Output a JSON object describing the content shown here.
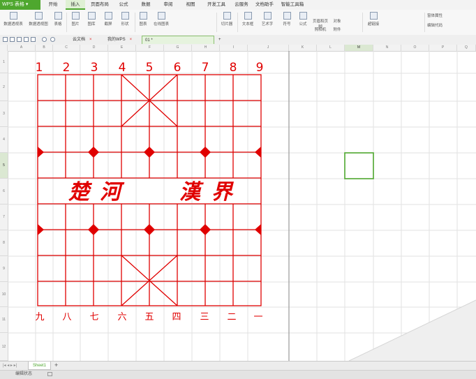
{
  "app": {
    "name": "WPS 表格"
  },
  "menu": [
    "开始",
    "插入",
    "页面布局",
    "公式",
    "数据",
    "审阅",
    "视图",
    "开发工具",
    "云服务",
    "文档助手",
    "智能工具箱"
  ],
  "ribbon": {
    "buttons": [
      "数据透视表",
      "数据透视图",
      "表格",
      "图片",
      "图库",
      "截屏",
      "形状",
      "图表",
      "在线图表",
      "切片器",
      "文本框",
      "艺术字",
      "符号",
      "公式",
      "超链接"
    ],
    "small": [
      "页眉和页脚",
      "对象",
      "照相机",
      "附件",
      "窗体属性",
      "编辑代码"
    ]
  },
  "tabs": [
    {
      "label": "云文档"
    },
    {
      "label": "我的WPS"
    },
    {
      "label": "01 *"
    }
  ],
  "columns": [
    "A",
    "B",
    "C",
    "D",
    "E",
    "F",
    "G",
    "H",
    "I",
    "J",
    "K",
    "L",
    "M",
    "N",
    "O",
    "P",
    "Q"
  ],
  "rows": [
    "1",
    "2",
    "3",
    "4",
    "5",
    "6",
    "7",
    "8",
    "9",
    "10",
    "11",
    "12"
  ],
  "selected_cell": {
    "column": "M",
    "row": "5"
  },
  "board": {
    "top_numbers": [
      "1",
      "2",
      "3",
      "4",
      "5",
      "6",
      "7",
      "8",
      "9"
    ],
    "bottom_numbers": [
      "九",
      "八",
      "七",
      "六",
      "五",
      "四",
      "三",
      "二",
      "一"
    ],
    "river_text": [
      "楚",
      "河",
      "漢",
      "界"
    ]
  },
  "sheets": {
    "active": "Sheet1",
    "add": "+"
  },
  "status": {
    "mode": "编辑状态"
  },
  "colors": {
    "accent": "#4ea72e",
    "board": "#e00000"
  }
}
